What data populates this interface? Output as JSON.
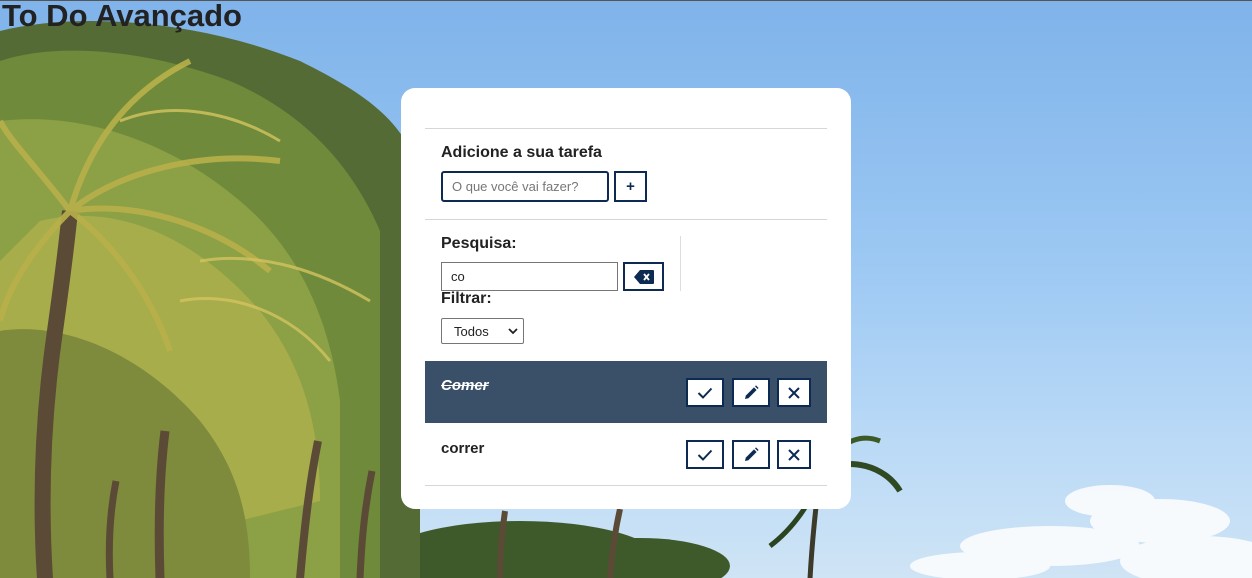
{
  "app": {
    "title": "To Do Avançado"
  },
  "add_form": {
    "label": "Adicione a sua tarefa",
    "input_placeholder": "O que você vai fazer?",
    "input_value": "",
    "submit_label": "+"
  },
  "search": {
    "label": "Pesquisa:",
    "value": "co"
  },
  "filter": {
    "label": "Filtrar:",
    "selected": "Todos"
  },
  "todos": [
    {
      "title": "Comer",
      "done": true
    },
    {
      "title": "correr",
      "done": false
    }
  ],
  "icons": {
    "finish": "check-icon",
    "edit": "pencil-icon",
    "remove": "x-icon",
    "erase": "backspace-icon",
    "select": "chevron-down-icon"
  },
  "colors": {
    "accent": "#0d2b52",
    "done_row": "#3a5068",
    "card": "#ffffff"
  }
}
